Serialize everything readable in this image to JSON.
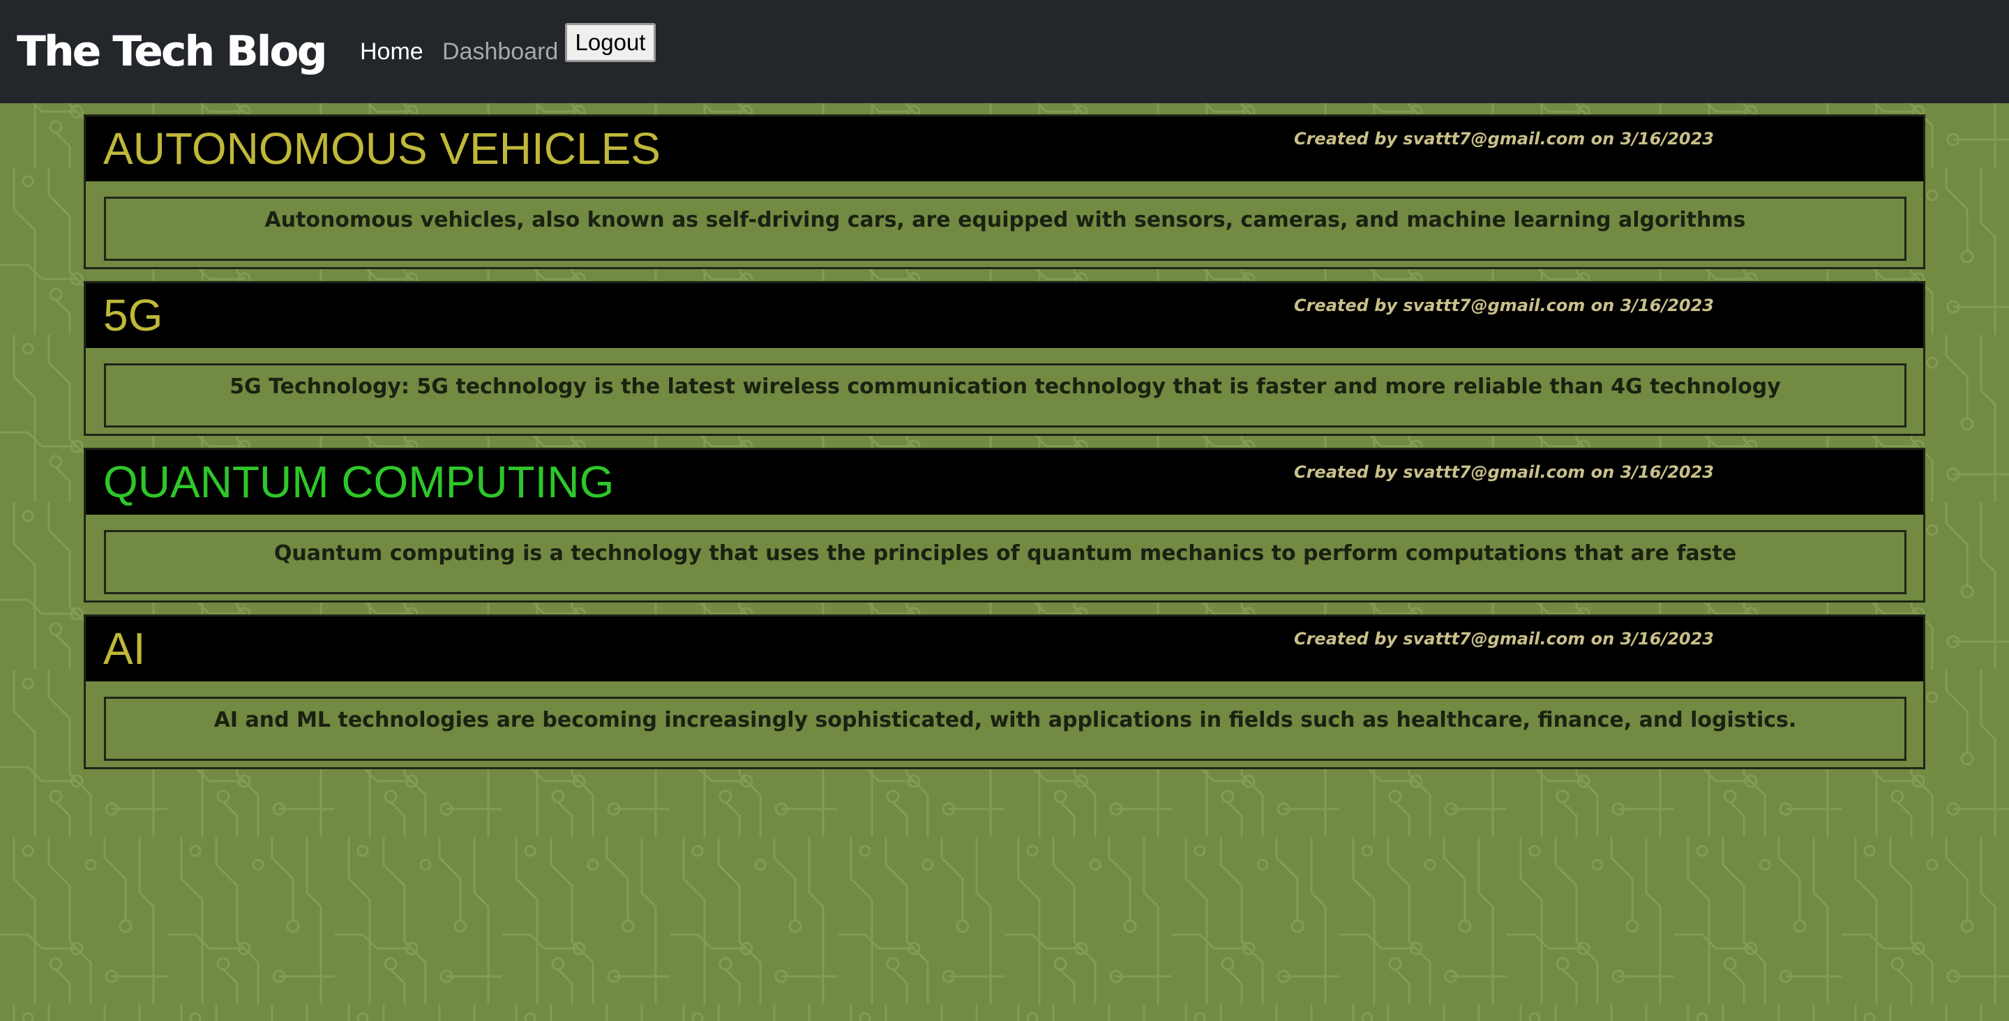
{
  "navbar": {
    "brand": "The Tech Blog",
    "links": {
      "home": "Home",
      "dashboard": "Dashboard"
    },
    "logout_label": "Logout"
  },
  "posts": [
    {
      "title": "AUTONOMOUS VEHICLES",
      "title_color": "#bfb83a",
      "meta": "Created by svattt7@gmail.com on 3/16/2023",
      "content": "Autonomous vehicles, also known as self-driving cars, are equipped with sensors, cameras, and machine learning algorithms"
    },
    {
      "title": "5G",
      "title_color": "#bfb83a",
      "meta": "Created by svattt7@gmail.com on 3/16/2023",
      "content": "5G Technology: 5G technology is the latest wireless communication technology that is faster and more reliable than 4G technology"
    },
    {
      "title": "QUANTUM COMPUTING",
      "title_color": "#2fc62a",
      "meta": "Created by svattt7@gmail.com on 3/16/2023",
      "content": "Quantum computing is a technology that uses the principles of quantum mechanics to perform computations that are faste"
    },
    {
      "title": "AI",
      "title_color": "#bfb83a",
      "meta": "Created by svattt7@gmail.com on 3/16/2023",
      "content": "AI and ML technologies are becoming increasingly sophisticated, with applications in fields such as healthcare, finance, and logistics."
    }
  ],
  "colors": {
    "navbar_bg": "#23262b",
    "page_bg": "#728a42",
    "circuit_line": "#8fa85e",
    "post_header_bg": "#000000",
    "meta_text": "#c9c08a"
  }
}
